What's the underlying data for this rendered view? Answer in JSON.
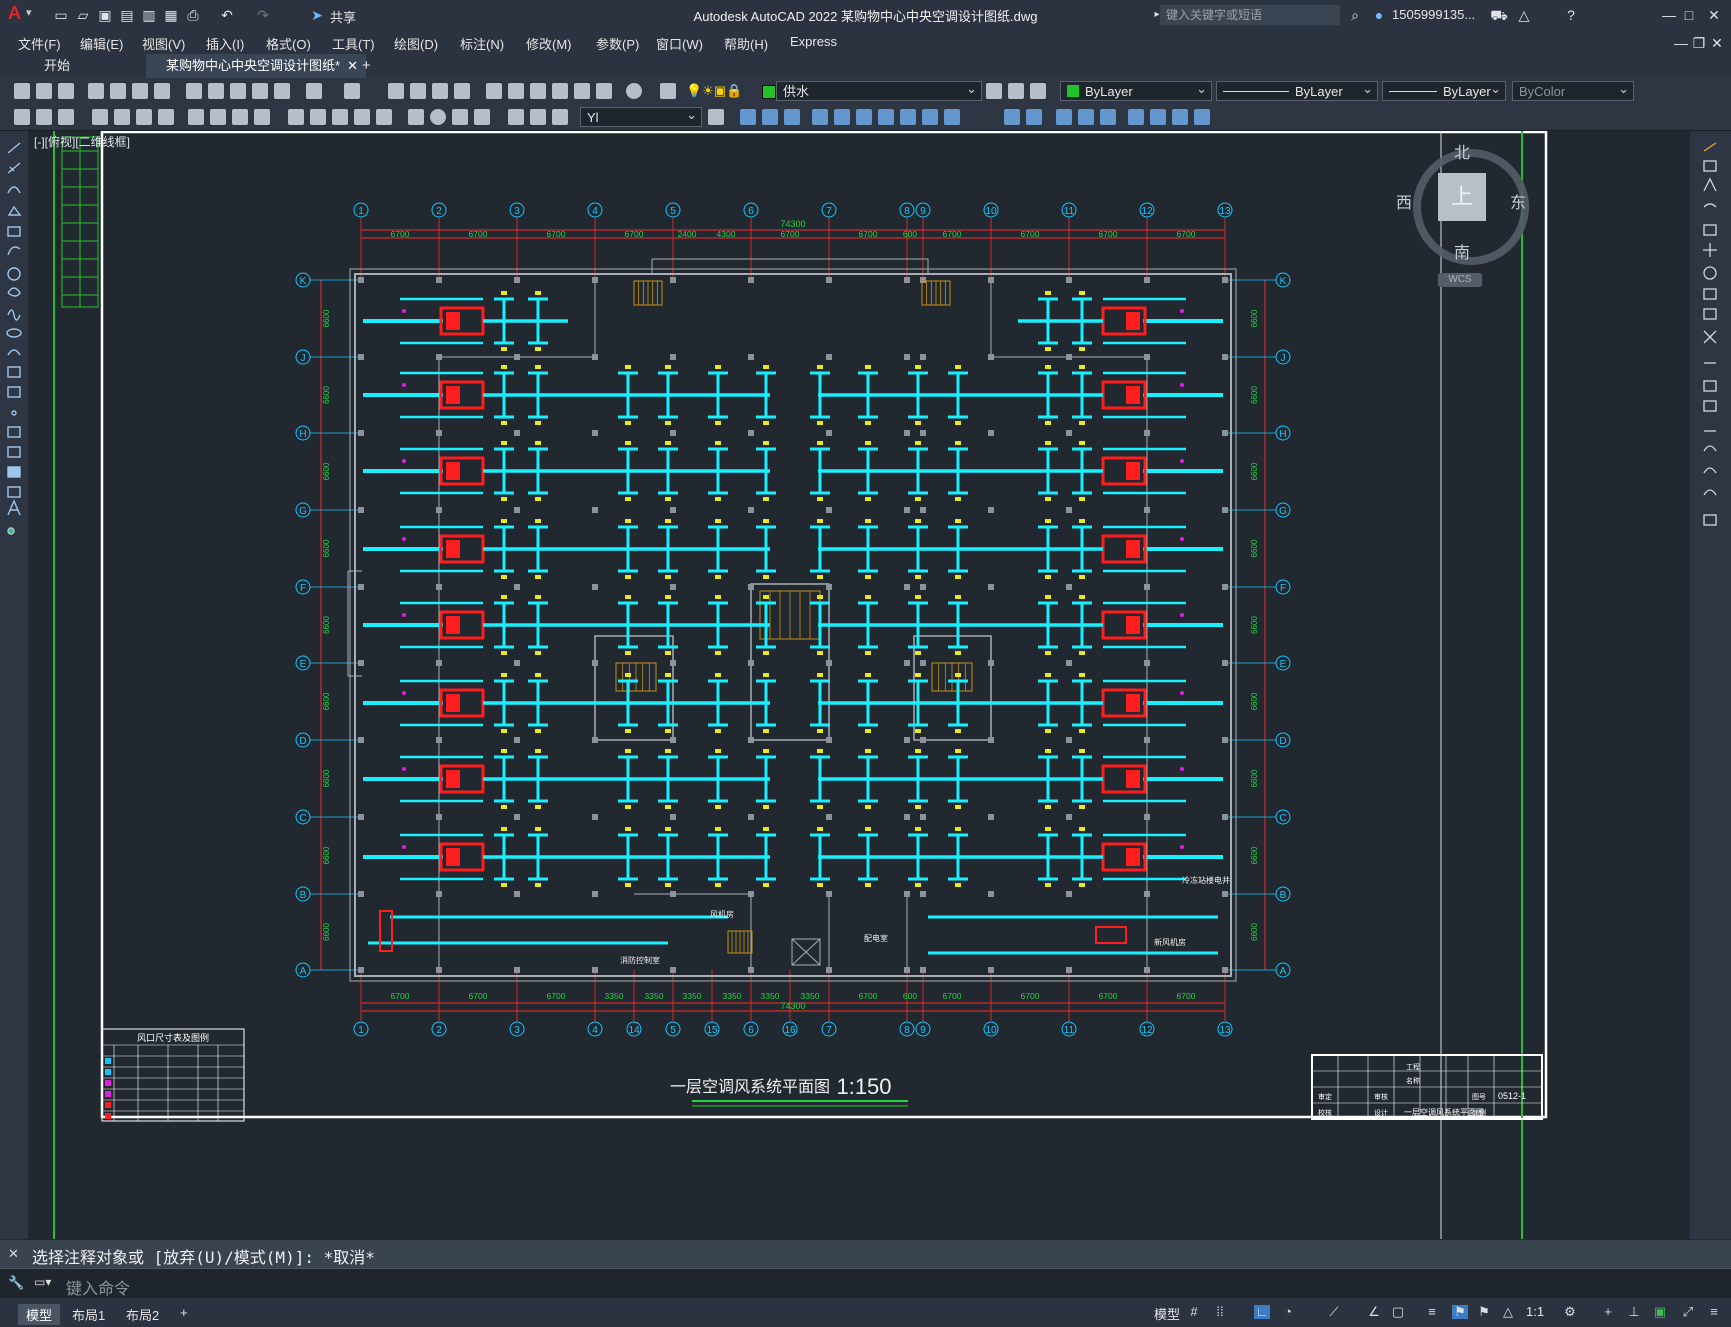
{
  "app": {
    "logo": "A",
    "title": "Autodesk AutoCAD 2022    某购物中心中央空调设计图纸.dwg",
    "search_placeholder": "键入关键字或短语",
    "user": "1505999135...",
    "share": "共享"
  },
  "menu": [
    "文件(F)",
    "编辑(E)",
    "视图(V)",
    "插入(I)",
    "格式(O)",
    "工具(T)",
    "绘图(D)",
    "标注(N)",
    "修改(M)",
    "参数(P)",
    "窗口(W)",
    "帮助(H)",
    "Express"
  ],
  "tabs": {
    "start": "开始",
    "active": "某购物中心中央空调设计图纸*",
    "add": "+"
  },
  "toolbar": {
    "layer": "供水",
    "color": "ByLayer",
    "linetype": "ByLayer",
    "lineweight": "ByLayer",
    "plotstyle": "ByColor",
    "dimstyle": "Yl"
  },
  "viewport_label": "[-][俯视][二维线框]",
  "viewcube": {
    "north": "北",
    "south": "南",
    "east": "东",
    "west": "西",
    "top": "上",
    "wcs": "WCS"
  },
  "drawing": {
    "title": "一层空调风系统平面图",
    "scale": "1:150",
    "total_dim": "74300",
    "col_top": [
      "1",
      "2",
      "3",
      "4",
      "5",
      "6",
      "7",
      "8",
      "9",
      "10",
      "11",
      "12",
      "13"
    ],
    "col_bottom": [
      "1",
      "2",
      "3",
      "4",
      "14",
      "5",
      "15",
      "6",
      "16",
      "7",
      "8",
      "9",
      "10",
      "11",
      "12",
      "13"
    ],
    "rows": [
      "K",
      "J",
      "H",
      "G",
      "F",
      "E",
      "D",
      "C",
      "B",
      "A"
    ],
    "dims_top": [
      "6700",
      "6700",
      "6700",
      "6700",
      "2400",
      "4300",
      "6700",
      "6700",
      "600",
      "6700",
      "6700",
      "6700",
      "6700"
    ],
    "dims_bottom": [
      "6700",
      "6700",
      "6700",
      "3350",
      "3350",
      "3350",
      "3350",
      "3350",
      "3350",
      "6700",
      "600",
      "6700",
      "6700",
      "6700",
      "6700"
    ],
    "row_dims": [
      "6600",
      "6600",
      "6600",
      "6600",
      "6600",
      "6600",
      "6600",
      "6600",
      "6600"
    ],
    "room_labels": [
      "楼电井",
      "消防控制室",
      "配电室",
      "风机房",
      "新风机房",
      "冷冻站"
    ],
    "legend_title": "风口尺寸表及图例",
    "titleblock": {
      "sheet": "一层空调风系统平面图",
      "code": "0512-1",
      "cells": [
        "工程",
        "名称",
        "审定",
        "校核",
        "审核",
        "设计",
        "图号",
        "比例"
      ]
    }
  },
  "command": {
    "history": "选择注释对象或 [放弃(U)/模式(M)]: *取消*",
    "placeholder": "键入命令"
  },
  "layouts": [
    "模型",
    "布局1",
    "布局2",
    "+"
  ],
  "status": {
    "model": "模型",
    "scale": "1:1"
  }
}
